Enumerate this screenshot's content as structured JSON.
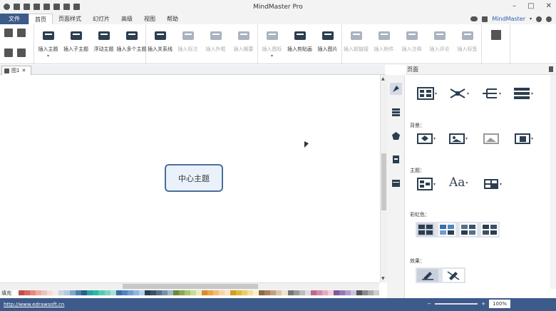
{
  "app": {
    "title": "MindMaster Pro",
    "brand": "MindMaster"
  },
  "menu": {
    "file": "文件",
    "tabs": [
      "首页",
      "页面样式",
      "幻灯片",
      "高级",
      "视图",
      "帮助"
    ],
    "active_tab": "首页"
  },
  "ribbon": {
    "items": [
      {
        "label": "插入主题",
        "enabled": true,
        "dropdown": true
      },
      {
        "label": "插入子主题",
        "enabled": true,
        "dropdown": false
      },
      {
        "label": "浮动主题",
        "enabled": true,
        "dropdown": false
      },
      {
        "label": "插入多个主题",
        "enabled": true,
        "dropdown": false
      },
      {
        "label": "插入关系线",
        "enabled": true,
        "dropdown": false
      },
      {
        "label": "插入标注",
        "enabled": false,
        "dropdown": false
      },
      {
        "label": "插入外框",
        "enabled": false,
        "dropdown": false
      },
      {
        "label": "插入概要",
        "enabled": false,
        "dropdown": false
      },
      {
        "label": "插入图标",
        "enabled": false,
        "dropdown": true
      },
      {
        "label": "插入剪贴画",
        "enabled": true,
        "dropdown": false
      },
      {
        "label": "插入图片",
        "enabled": true,
        "dropdown": false
      },
      {
        "label": "插入超链接",
        "enabled": false,
        "dropdown": false
      },
      {
        "label": "插入附件",
        "enabled": false,
        "dropdown": false
      },
      {
        "label": "插入注释",
        "enabled": false,
        "dropdown": false
      },
      {
        "label": "插入评论",
        "enabled": false,
        "dropdown": false
      },
      {
        "label": "插入标签",
        "enabled": false,
        "dropdown": false
      }
    ]
  },
  "document": {
    "tab_name": "图1",
    "central_topic": "中心主题"
  },
  "palette": {
    "label": "填充",
    "colors": [
      "#ffffff",
      "#c0504d",
      "#d46a5e",
      "#e38b7d",
      "#f0aa9c",
      "#e8c5be",
      "#f7dcd5",
      "#eee",
      "#c9d6e4",
      "#b3c9dc",
      "#7fa8c9",
      "#4a7fab",
      "#2e5e8a",
      "#26a49d",
      "#2fb5a3",
      "#5ac6b6",
      "#7ad3c4",
      "#a8e0d6",
      "#3a6fa8",
      "#4f86bf",
      "#6d9ed0",
      "#8eb6dc",
      "#b4cfe8",
      "#2c3e50",
      "#3d5166",
      "#55708a",
      "#7690aa",
      "#a0b6c9",
      "#6a8a3a",
      "#8aa84c",
      "#aac46a",
      "#c8dc92",
      "#e3efc1",
      "#e08a2c",
      "#eba34c",
      "#f3bc74",
      "#f9d4a2",
      "#fbe6c8",
      "#d4a017",
      "#e0b83a",
      "#ebcc68",
      "#f4e09e",
      "#faf0cc",
      "#8a6a4a",
      "#a6845e",
      "#c2a27e",
      "#dcc4a6",
      "#eee2d2",
      "#777",
      "#999",
      "#bbb",
      "#ddd",
      "#c06a8a",
      "#d48aa6",
      "#e3abc0",
      "#f0cdd9",
      "#7a5a9a",
      "#9478b2",
      "#b09cc9",
      "#cec0e0",
      "#555",
      "#888",
      "#aaa",
      "#ccc"
    ]
  },
  "status": {
    "url": "http://www.edrawsoft.cn",
    "zoom": "100%"
  },
  "panel": {
    "title": "页面",
    "sections": {
      "background": "背景：",
      "theme": "主题：",
      "rainbow": "彩虹色：",
      "effects": "效果："
    }
  },
  "colors": {
    "accent": "#3c5a8a",
    "node_border": "#4b6e99",
    "node_fill": "#eaf1fa"
  }
}
